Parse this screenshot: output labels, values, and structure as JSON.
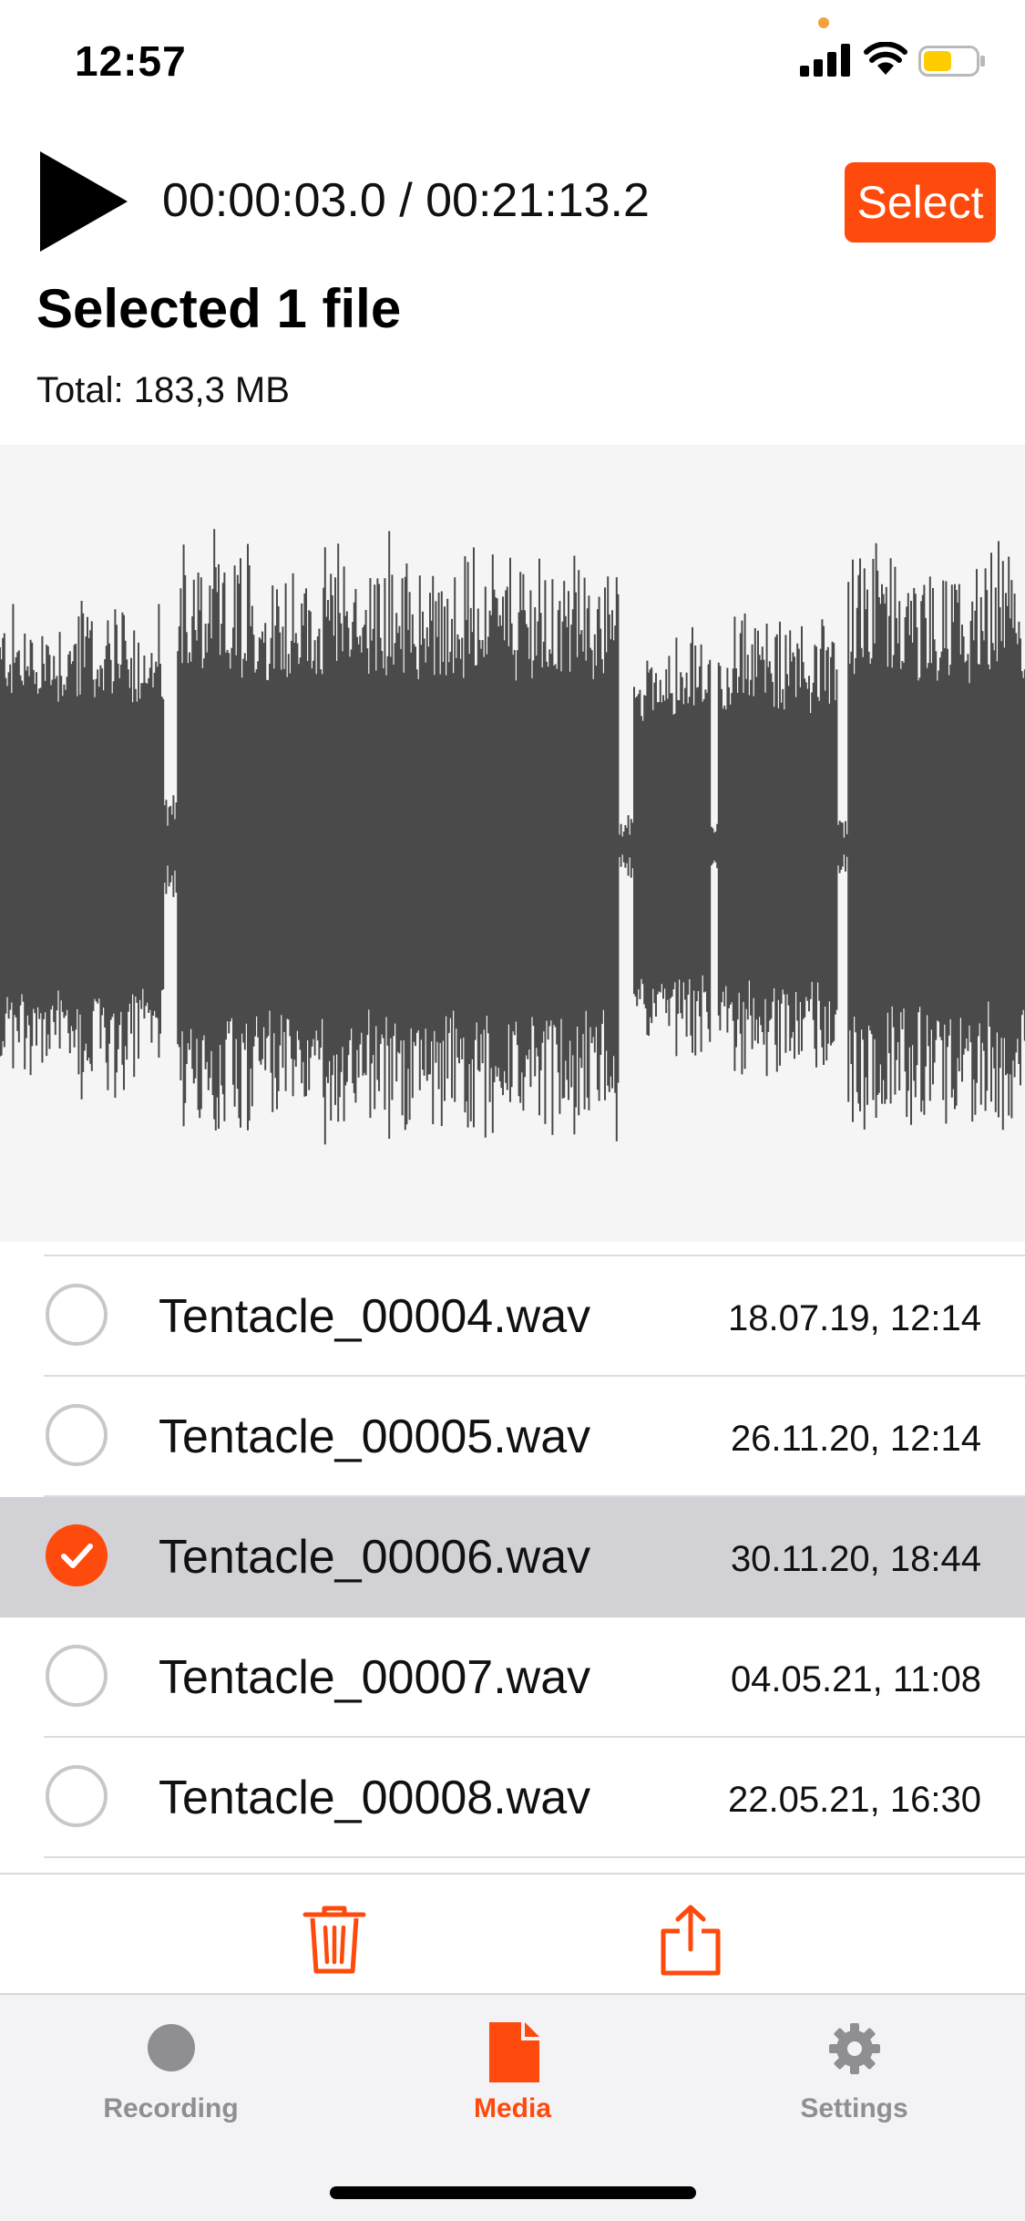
{
  "status_bar": {
    "time": "12:57",
    "icons": [
      "signal-bars-icon",
      "wifi-icon",
      "battery-icon"
    ],
    "battery_level": 0.55,
    "battery_color": "#ffcc00"
  },
  "player": {
    "play_icon": "play-icon",
    "time_readout": "00:00:03.0 / 00:21:13.2",
    "select_label": "Select"
  },
  "summary": {
    "title": "Selected 1 file",
    "total": "Total: 183,3 MB"
  },
  "files": [
    {
      "name": "Tentacle_00004.wav",
      "date": "18.07.19, 12:14",
      "selected": false
    },
    {
      "name": "Tentacle_00005.wav",
      "date": "26.11.20, 12:14",
      "selected": false
    },
    {
      "name": "Tentacle_00006.wav",
      "date": "30.11.20, 18:44",
      "selected": true
    },
    {
      "name": "Tentacle_00007.wav",
      "date": "04.05.21, 11:08",
      "selected": false
    },
    {
      "name": "Tentacle_00008.wav",
      "date": "22.05.21, 16:30",
      "selected": false
    }
  ],
  "actions": {
    "trash_icon": "trash-icon",
    "share_icon": "share-icon"
  },
  "tabs": [
    {
      "label": "Recording",
      "icon": "record-dot-icon",
      "active": false
    },
    {
      "label": "Media",
      "icon": "document-icon",
      "active": true
    },
    {
      "label": "Settings",
      "icon": "gear-icon",
      "active": false
    }
  ],
  "colors": {
    "accent": "#fe4a0c",
    "waveform": "#4a4a4a",
    "waveform_background": "#f5f5f6",
    "selected_row": "#d1d1d6",
    "inactive_tab": "#8e8e93"
  }
}
